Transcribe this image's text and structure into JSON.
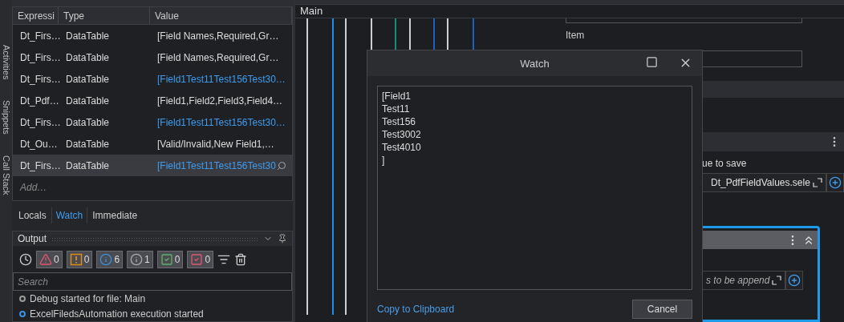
{
  "side_tabs": [
    "Activities",
    "Snippets",
    "Call Stack"
  ],
  "watch": {
    "columns": [
      "Expressi",
      "Type",
      "Value"
    ],
    "rows": [
      {
        "expression": "Dt_Firs…",
        "type": "DataTable",
        "value": "[Field Names,Required,Gr…",
        "changed": false,
        "selected": false
      },
      {
        "expression": "Dt_Firs…",
        "type": "DataTable",
        "value": "[Field Names,Required,Gr…",
        "changed": false,
        "selected": false
      },
      {
        "expression": "Dt_Firs…",
        "type": "DataTable",
        "value": "[Field1Test11Test156Test30…",
        "changed": true,
        "selected": false
      },
      {
        "expression": "Dt_Pdf…",
        "type": "DataTable",
        "value": "[Field1,Field2,Field3,Field4…",
        "changed": false,
        "selected": false
      },
      {
        "expression": "Dt_Firs…",
        "type": "DataTable",
        "value": "[Field1Test11Test156Test30…",
        "changed": true,
        "selected": false
      },
      {
        "expression": "Dt_Ou…",
        "type": "DataTable",
        "value": "[Valid/Invalid,New Field1,…",
        "changed": false,
        "selected": false
      },
      {
        "expression": "Dt_Firs…",
        "type": "DataTable",
        "value": "[Field1Test11Test156Test30",
        "changed": true,
        "selected": true
      }
    ],
    "add_placeholder": "Add…"
  },
  "debug_tabs": [
    {
      "label": "Locals",
      "selected": false
    },
    {
      "label": "Watch",
      "selected": true
    },
    {
      "label": "Immediate",
      "selected": false
    }
  ],
  "output": {
    "title": "Output",
    "filters": [
      {
        "kind": "error",
        "count": "0",
        "selected": true
      },
      {
        "kind": "warning",
        "count": "0",
        "selected": true
      },
      {
        "kind": "info",
        "count": "6",
        "selected": true
      },
      {
        "kind": "trace",
        "count": "1",
        "selected": true
      },
      {
        "kind": "success",
        "count": "0",
        "selected": true
      },
      {
        "kind": "failure",
        "count": "0",
        "selected": true
      }
    ],
    "search_placeholder": "Search",
    "logs": [
      {
        "text": "Debug started for file: Main",
        "color": "#9a9a9a"
      },
      {
        "text": "ExcelFiledsAutomation execution started",
        "color": "#3c8fe0"
      }
    ]
  },
  "main": {
    "title": "Main"
  },
  "properties": {
    "item_label": "Item",
    "save_label": "ue to save",
    "save_value": "Dt_PdfFieldValues.sele",
    "append_placeholder": "s to be append"
  },
  "dialog": {
    "title": "Watch",
    "content": "[Field1\nTest11\nTest156\nTest3002\nTest4010\n]",
    "link": "Copy to Clipboard",
    "button": "Cancel"
  }
}
